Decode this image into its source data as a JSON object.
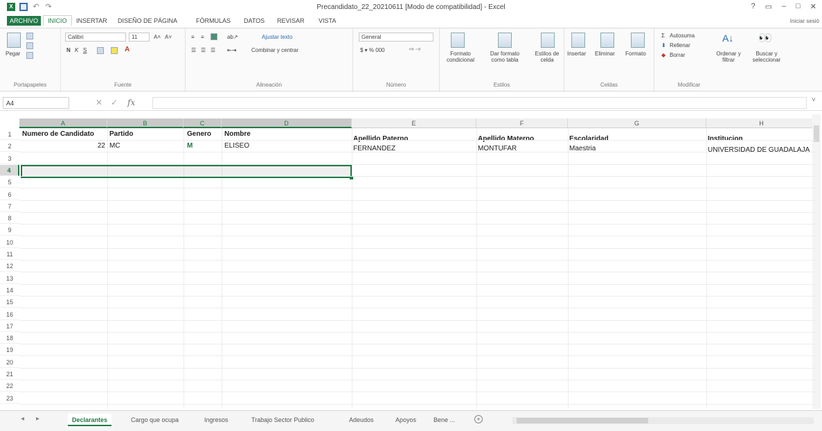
{
  "window": {
    "title": "Precandidato_22_20210611 [Modo de compatibilidad] - Excel",
    "controls": [
      "?",
      "▭",
      "–",
      "□",
      "✕"
    ]
  },
  "ribbon_tabs": [
    "ARCHIVO",
    "INICIO",
    "INSERTAR",
    "DISEÑO DE PÁGINA",
    "FÓRMULAS",
    "DATOS",
    "REVISAR",
    "VISTA"
  ],
  "signin_label": "Iniciar sesió",
  "ribbon": {
    "clipboard": {
      "paste": "Pegar",
      "label": "Portapapeles"
    },
    "font": {
      "name": "Calibri",
      "size": "11",
      "bold": "N",
      "italic": "K",
      "underline": "S",
      "label": "Fuente"
    },
    "alignment": {
      "wrap": "Ajustar texto",
      "merge": "Combinar y centrar",
      "label": "Alineación"
    },
    "number": {
      "format": "General",
      "label": "Número"
    },
    "styles": {
      "conditional": "Formato condicional",
      "table": "Dar formato como tabla",
      "cell_styles": "Estilos de celda",
      "label": "Estilos"
    },
    "cells": {
      "insert": "Insertar",
      "delete": "Eliminar",
      "format": "Formato",
      "label": "Celdas"
    },
    "editing": {
      "autosum": "Autosuma",
      "fill": "Rellenar",
      "clear": "Borrar",
      "sort": "Ordenar y filtrar",
      "find": "Buscar y seleccionar",
      "label": "Modificar"
    }
  },
  "formula_bar": {
    "name_box": "A4",
    "fx": "fx",
    "value": ""
  },
  "columns": [
    "A",
    "B",
    "C",
    "D",
    "E",
    "F",
    "G",
    "H"
  ],
  "rows": [
    "1",
    "2",
    "3",
    "4",
    "5",
    "6",
    "7",
    "8",
    "9",
    "10",
    "11",
    "12",
    "13",
    "14",
    "15",
    "16",
    "17",
    "18",
    "19",
    "20",
    "21",
    "22",
    "23"
  ],
  "headers_row": {
    "a": "Numero de Candidato",
    "b": "Partido",
    "c": "Genero",
    "d": "Nombre",
    "e": "Apellido Paterno",
    "f": "Apellido Materno",
    "g": "Escolaridad",
    "h": "Institucion"
  },
  "data_row": {
    "a": "22",
    "b": "MC",
    "c": "M",
    "d": "ELISEO",
    "e": "FERNANDEZ",
    "f": "MONTUFAR",
    "g": "Maestria",
    "h": "UNIVERSIDAD DE GUADALAJA"
  },
  "sheet_tabs": [
    "Declarantes",
    "Cargo que ocupa",
    "Ingresos",
    "Trabajo Sector Publico",
    "Adeudos",
    "Apoyos",
    "Bene ..."
  ],
  "active_sheet": "Declarantes",
  "colors": {
    "accent": "#1f7a45"
  }
}
